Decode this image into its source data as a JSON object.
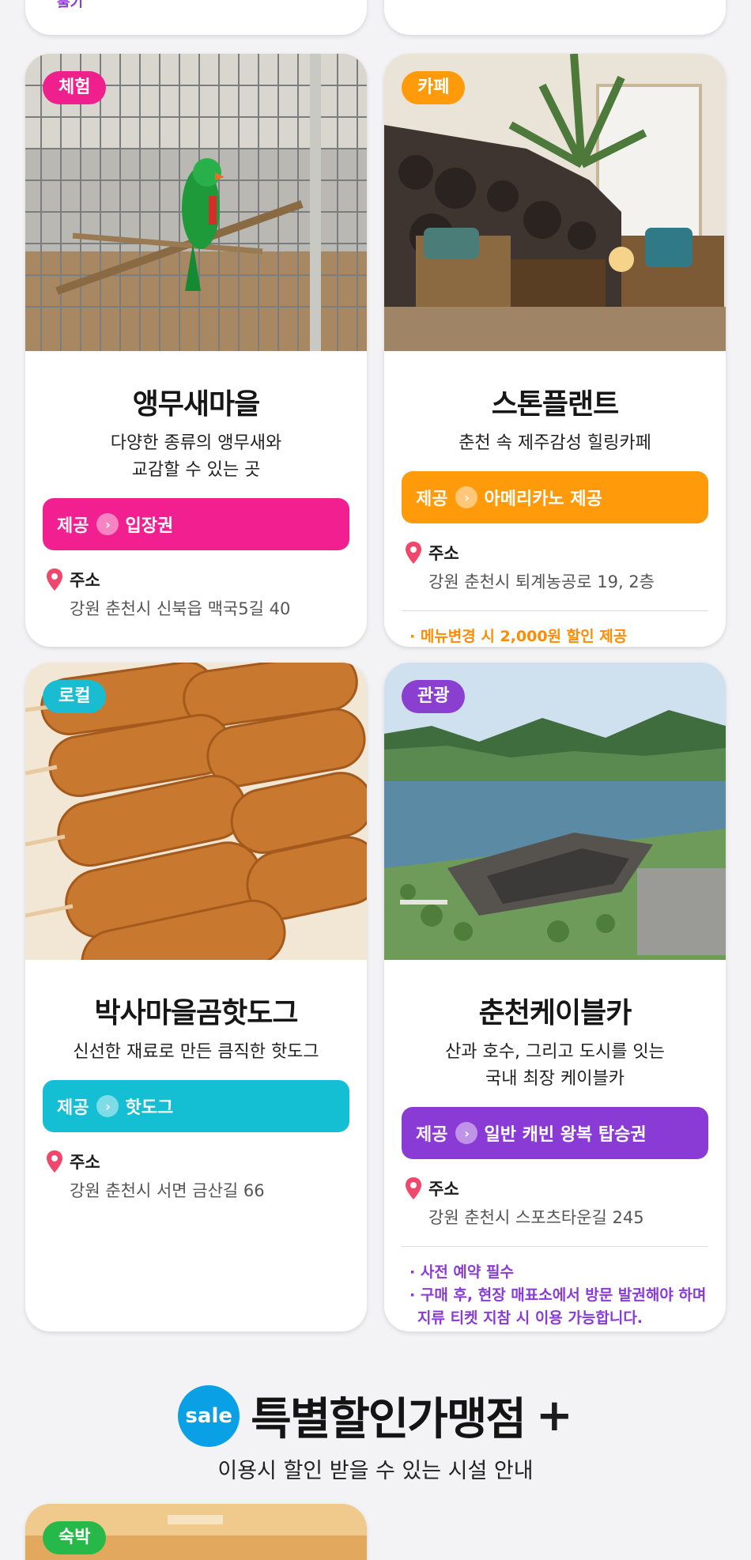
{
  "top_cards": {
    "partial_text": "물기"
  },
  "cards": [
    {
      "badge": "체험",
      "badge_color": "#ef1f8e",
      "title": "앵무새마을",
      "desc_lines": [
        "다양한 종류의 앵무새와",
        "교감할 수 있는 곳"
      ],
      "offer_label": "제공",
      "offer_value": "입장권",
      "offer_color": "#f11f90",
      "address_label": "주소",
      "address": "강원 춘천시 신북읍 맥국5길 40",
      "image": "parrot-in-cage-photo"
    },
    {
      "badge": "카페",
      "badge_color": "#ff9a0a",
      "title": "스톤플랜트",
      "desc_lines": [
        "춘천 속 제주감성 힐링카페"
      ],
      "offer_label": "제공",
      "offer_value": "아메리카노 제공",
      "offer_color": "#ff9a0a",
      "address_label": "주소",
      "address": "강원 춘천시 퇴계농공로 19, 2층",
      "notes": [
        "· 메뉴변경 시 2,000원 할인 제공"
      ],
      "note_color": "#ff8c00",
      "image": "stone-cafe-interior-photo"
    },
    {
      "badge": "로컬",
      "badge_color": "#19bcd0",
      "title": "박사마을곰핫도그",
      "desc_lines": [
        "신선한 재료로 만든 큼직한 핫도그"
      ],
      "offer_label": "제공",
      "offer_value": "핫도그",
      "offer_color": "#14bfd4",
      "address_label": "주소",
      "address": "강원 춘천시 서면 금산길 66",
      "image": "corn-dogs-photo"
    },
    {
      "badge": "관광",
      "badge_color": "#8a3fd1",
      "title": "춘천케이블카",
      "desc_lines": [
        "산과 호수, 그리고 도시를 잇는",
        "국내 최장 케이블카"
      ],
      "offer_label": "제공",
      "offer_value": "일반 캐빈 왕복 탑승권",
      "offer_color": "#8a3bd6",
      "address_label": "주소",
      "address": "강원 춘천시 스포츠타운길 245",
      "notes": [
        "· 사전 예약 필수",
        "· 구매 후, 현장 매표소에서 방문 발권해야 하며",
        "  지류 티켓 지참 시 이용 가능합니다."
      ],
      "note_color": "#8a3bd6",
      "image": "lake-and-mountain-aerial-photo"
    }
  ],
  "sale_section": {
    "badge": "sale",
    "title": "특별할인가맹점",
    "plus": "+",
    "subtitle": "이용시 할인 받을 수 있는 시설 안내"
  },
  "bottom_card": {
    "badge": "숙박",
    "badge_color": "#27b84a"
  }
}
